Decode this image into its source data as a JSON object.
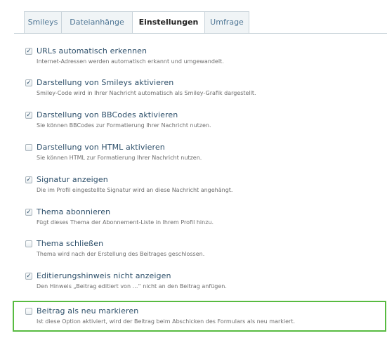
{
  "tabs": [
    {
      "label": "Smileys",
      "active": false
    },
    {
      "label": "Dateianhänge",
      "active": false
    },
    {
      "label": "Einstellungen",
      "active": true
    },
    {
      "label": "Umfrage",
      "active": false
    }
  ],
  "options": [
    {
      "title": "URLs automatisch erkennen",
      "description": "Internet-Adressen werden automatisch erkannt und umgewandelt.",
      "checked": true,
      "check_glyph": "✓"
    },
    {
      "title": "Darstellung von Smileys aktivieren",
      "description": "Smiley-Code wird in Ihrer Nachricht automatisch als Smiley-Grafik dargestellt.",
      "checked": true,
      "check_glyph": "✓"
    },
    {
      "title": "Darstellung von BBCodes aktivieren",
      "description": "Sie können BBCodes zur Formatierung Ihrer Nachricht nutzen.",
      "checked": true,
      "check_glyph": "✓"
    },
    {
      "title": "Darstellung von HTML aktivieren",
      "description": "Sie können HTML zur Formatierung Ihrer Nachricht nutzen.",
      "checked": false,
      "check_glyph": ""
    },
    {
      "title": "Signatur anzeigen",
      "description": "Die im Profil eingestellte Signatur wird an diese Nachricht angehängt.",
      "checked": true,
      "check_glyph": "✓"
    },
    {
      "title": "Thema abonnieren",
      "description": "Fügt dieses Thema der Abonnement-Liste in Ihrem Profil hinzu.",
      "checked": true,
      "check_glyph": "✓"
    },
    {
      "title": "Thema schließen",
      "description": "Thema wird nach der Erstellung des Beitrages geschlossen.",
      "checked": false,
      "check_glyph": ""
    },
    {
      "title": "Editierungshinweis nicht anzeigen",
      "description": "Den Hinweis „Beitrag editiert von …“ nicht an den Beitrag anfügen.",
      "checked": true,
      "check_glyph": "✓"
    },
    {
      "title": "Beitrag als neu markieren",
      "description": "Ist diese Option aktiviert, wird der Beitrag beim Abschicken des Formulars als neu markiert.",
      "checked": false,
      "check_glyph": "",
      "highlighted": true
    }
  ],
  "colors": {
    "tab_text": "#4f7695",
    "title_text": "#2d4f6a",
    "description_text": "#6d6d6d",
    "highlight_border": "#58bb41"
  }
}
